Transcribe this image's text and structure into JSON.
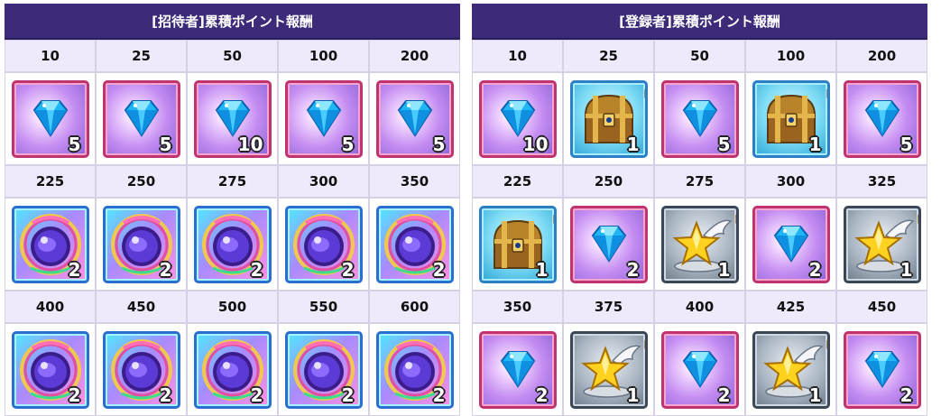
{
  "panels": [
    {
      "title": "[招待者]累積ポイント報酬",
      "rows": [
        {
          "thresholds": [
            "10",
            "25",
            "50",
            "100",
            "200"
          ],
          "rewards": [
            {
              "icon": "diamond-gem-icon",
              "qty": "5"
            },
            {
              "icon": "diamond-gem-icon",
              "qty": "5"
            },
            {
              "icon": "diamond-gem-icon",
              "qty": "10"
            },
            {
              "icon": "diamond-gem-icon",
              "qty": "5"
            },
            {
              "icon": "diamond-gem-icon",
              "qty": "5"
            }
          ]
        },
        {
          "thresholds": [
            "225",
            "250",
            "275",
            "300",
            "350"
          ],
          "rewards": [
            {
              "icon": "crystal-orb-icon",
              "qty": "2"
            },
            {
              "icon": "crystal-orb-icon",
              "qty": "2"
            },
            {
              "icon": "crystal-orb-icon",
              "qty": "2"
            },
            {
              "icon": "crystal-orb-icon",
              "qty": "2"
            },
            {
              "icon": "crystal-orb-icon",
              "qty": "2"
            }
          ]
        },
        {
          "thresholds": [
            "400",
            "450",
            "500",
            "550",
            "600"
          ],
          "rewards": [
            {
              "icon": "crystal-orb-icon",
              "qty": "2"
            },
            {
              "icon": "crystal-orb-icon",
              "qty": "2"
            },
            {
              "icon": "crystal-orb-icon",
              "qty": "2"
            },
            {
              "icon": "crystal-orb-icon",
              "qty": "2"
            },
            {
              "icon": "crystal-orb-icon",
              "qty": "2"
            }
          ]
        }
      ]
    },
    {
      "title": "[登録者]累積ポイント報酬",
      "rows": [
        {
          "thresholds": [
            "10",
            "25",
            "50",
            "100",
            "200"
          ],
          "rewards": [
            {
              "icon": "diamond-gem-icon",
              "qty": "10"
            },
            {
              "icon": "treasure-chest-icon",
              "qty": "1"
            },
            {
              "icon": "diamond-gem-icon",
              "qty": "5"
            },
            {
              "icon": "treasure-chest-icon",
              "qty": "1"
            },
            {
              "icon": "diamond-gem-icon",
              "qty": "5"
            }
          ]
        },
        {
          "thresholds": [
            "225",
            "250",
            "275",
            "300",
            "325"
          ],
          "rewards": [
            {
              "icon": "treasure-chest-icon",
              "qty": "1"
            },
            {
              "icon": "diamond-gem-icon",
              "qty": "2"
            },
            {
              "icon": "winged-star-icon",
              "qty": "1"
            },
            {
              "icon": "diamond-gem-icon",
              "qty": "2"
            },
            {
              "icon": "winged-star-icon",
              "qty": "1"
            }
          ]
        },
        {
          "thresholds": [
            "350",
            "375",
            "400",
            "425",
            "450"
          ],
          "rewards": [
            {
              "icon": "diamond-gem-icon",
              "qty": "2"
            },
            {
              "icon": "winged-star-icon",
              "qty": "1"
            },
            {
              "icon": "diamond-gem-icon",
              "qty": "2"
            },
            {
              "icon": "winged-star-icon",
              "qty": "1"
            },
            {
              "icon": "diamond-gem-icon",
              "qty": "2"
            }
          ]
        }
      ]
    }
  ]
}
